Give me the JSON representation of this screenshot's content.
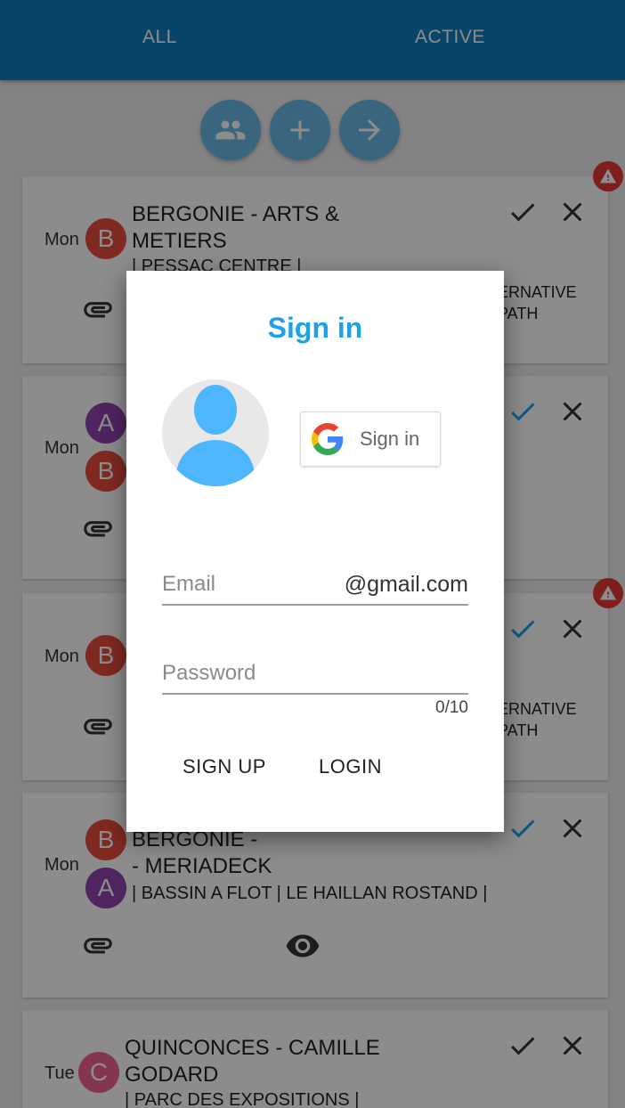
{
  "tabs": {
    "all": "ALL",
    "active": "ACTIVE"
  },
  "fabs": [
    "group-icon",
    "add-icon",
    "arrow-forward-icon"
  ],
  "cards": [
    {
      "day": "Mon",
      "avatars": [
        "B"
      ],
      "title_line1": "BERGONIE - ARTS &",
      "title_line2": "METIERS",
      "subtitle": "| PESSAC CENTRE |",
      "alt_line1": "ERNATIVE",
      "alt_line2": "PATH",
      "warning": true
    },
    {
      "day": "Mon",
      "avatars": [
        "A",
        "B"
      ],
      "warning": false
    },
    {
      "day": "Mon",
      "avatars": [
        "B"
      ],
      "alt_line1": "ERNATIVE",
      "alt_line2": "PATH",
      "warning": true
    },
    {
      "day": "Mon",
      "avatars": [
        "B",
        "A"
      ],
      "title_line1": "BERGONIE -",
      "title_line2": "- MERIADECK",
      "subtitle": "| BASSIN A FLOT | LE HAILLAN ROSTAND |",
      "warning": false
    },
    {
      "day": "Tue",
      "avatars": [
        "C"
      ],
      "title_line1": "QUINCONCES - CAMILLE",
      "title_line2": "GODARD",
      "subtitle": "| PARC DES EXPOSITIONS |",
      "warning": false
    }
  ],
  "dialog": {
    "title": "Sign in",
    "google_button": "Sign in",
    "email_placeholder": "Email",
    "email_suffix": "@gmail.com",
    "password_placeholder": "Password",
    "password_counter": "0/10",
    "signup_label": "SIGN UP",
    "login_label": "LOGIN"
  },
  "colors": {
    "header": "#0f7fbf",
    "accent": "#1ea1e8",
    "avatar_b": "#e74c3c",
    "avatar_a": "#8e44ad",
    "avatar_c": "#f06292",
    "warning": "#e53935"
  }
}
